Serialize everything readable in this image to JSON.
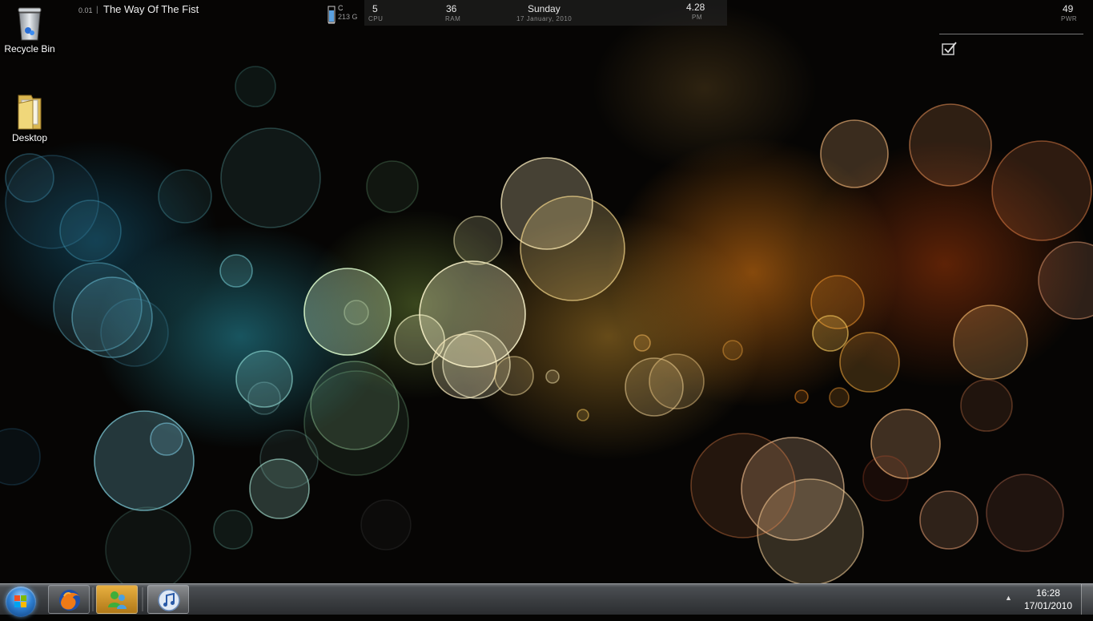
{
  "desktop": {
    "icons": [
      {
        "label": "Recycle Bin",
        "icon": "recycle-bin-icon"
      },
      {
        "label": "Desktop",
        "icon": "folder-icon"
      }
    ]
  },
  "now_playing": {
    "time": "0.01",
    "separator": "|",
    "title": "The Way Of The Fist"
  },
  "drive": {
    "letter": "C",
    "free": "213 G"
  },
  "stats": {
    "cpu_value": "5",
    "cpu_label": "CPU",
    "ram_value": "36",
    "ram_label": "RAM",
    "day": "Sunday",
    "date": "17 January, 2010",
    "time": "4.28",
    "ampm": "PM",
    "power_value": "49",
    "power_label": "PWR"
  },
  "todo": {
    "icon": "checkbox-icon"
  },
  "taskbar": {
    "start": "windows-start-icon",
    "pinned": [
      "firefox-icon",
      "messenger-icon",
      "itunes-icon"
    ],
    "clock_time": "16:28",
    "clock_date": "17/01/2010"
  },
  "colors": {
    "taskbar": "#3a3d40",
    "wallpaper_teal": "#2896aa",
    "wallpaper_orange": "#f08214"
  }
}
